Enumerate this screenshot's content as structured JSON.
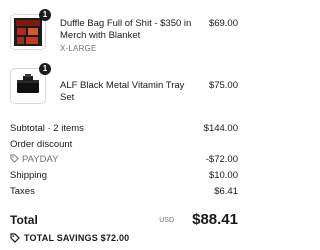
{
  "items": [
    {
      "qty": "1",
      "name": "Duffle Bag Full of Shit - $350 in Merch with Blanket",
      "variant": "X-LARGE",
      "price": "$69.00",
      "thumb_icon": "duffle-bag-product-image"
    },
    {
      "qty": "1",
      "name": "ALF Black Metal Vitamin Tray Set",
      "variant": "",
      "price": "$75.00",
      "thumb_icon": "vitamin-tray-product-image"
    }
  ],
  "summary": {
    "subtotal_label": "Subtotal · 2 items",
    "subtotal_value": "$144.00",
    "order_discount_label": "Order discount",
    "discount_code": "PAYDAY",
    "discount_value": "-$72.00",
    "shipping_label": "Shipping",
    "shipping_value": "$10.00",
    "taxes_label": "Taxes",
    "taxes_value": "$6.41"
  },
  "total": {
    "label": "Total",
    "currency": "USD",
    "value": "$88.41"
  },
  "savings": {
    "label": "TOTAL SAVINGS $72.00",
    "icon": "tag-icon"
  },
  "colors": {
    "text": "#1a1a1a",
    "muted": "#707070",
    "badge": "#1c1c1c",
    "border": "#d9d9d9"
  }
}
